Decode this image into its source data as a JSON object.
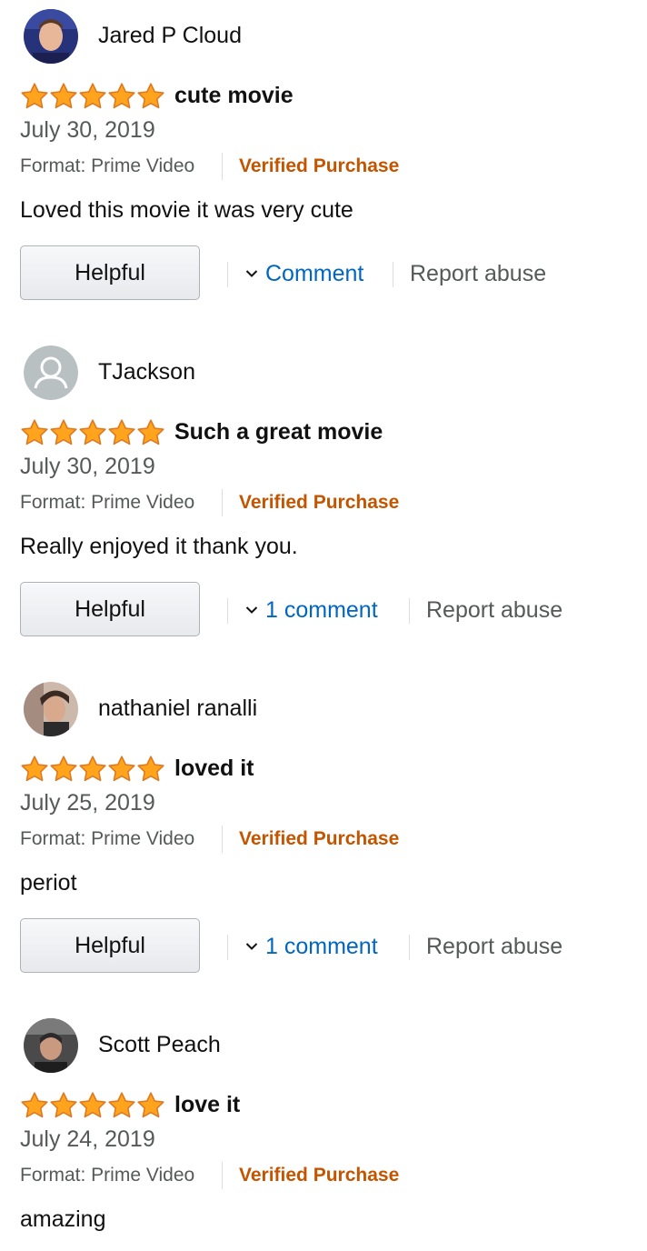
{
  "reviews": [
    {
      "reviewer": "Jared P Cloud",
      "avatar": "avatar-photo",
      "rating": 5,
      "title": "cute movie",
      "date": "July 30, 2019",
      "format": "Format: Prime Video",
      "verified": "Verified Purchase",
      "text": "Loved this movie it was very cute",
      "helpful_label": "Helpful",
      "comment_label": "Comment",
      "report_label": "Report abuse"
    },
    {
      "reviewer": "TJackson",
      "avatar": "default-user-icon",
      "rating": 5,
      "title": "Such a great movie",
      "date": "July 30, 2019",
      "format": "Format: Prime Video",
      "verified": "Verified Purchase",
      "text": "Really enjoyed it thank you.",
      "helpful_label": "Helpful",
      "comment_label": "1 comment",
      "report_label": "Report abuse"
    },
    {
      "reviewer": "nathaniel ranalli",
      "avatar": "avatar-photo",
      "rating": 5,
      "title": "loved it",
      "date": "July 25, 2019",
      "format": "Format: Prime Video",
      "verified": "Verified Purchase",
      "text": "periot",
      "helpful_label": "Helpful",
      "comment_label": "1 comment",
      "report_label": "Report abuse"
    },
    {
      "reviewer": "Scott Peach",
      "avatar": "avatar-photo",
      "rating": 5,
      "title": "love it",
      "date": "July 24, 2019",
      "format": "Format: Prime Video",
      "verified": "Verified Purchase",
      "text": "amazing"
    }
  ],
  "colors": {
    "star": "#ffa41c",
    "star_outline": "#de7921",
    "verified": "#c45500",
    "link": "#0066c0",
    "secondary_text": "#565959"
  }
}
